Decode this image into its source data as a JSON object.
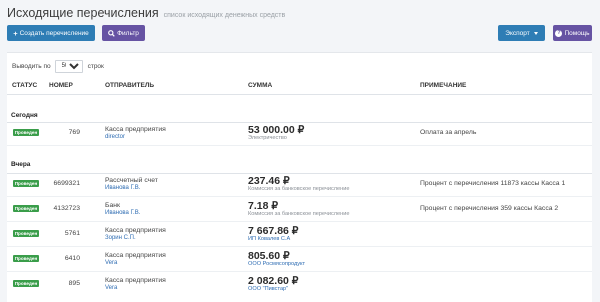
{
  "header": {
    "title": "Исходящие перечисления",
    "subtitle": "список исходящих денежных средств"
  },
  "toolbar": {
    "create_label": "Создать перечисление",
    "filter_label": "Фильтр",
    "export_label": "Экспорт",
    "help_label": "Помощь"
  },
  "per_page": {
    "prefix": "Выводить по",
    "value": "50",
    "suffix": "строк"
  },
  "columns": {
    "status": "СТАТУС",
    "number": "НОМЕР",
    "sender": "ОТПРАВИТЕЛЬ",
    "amount": "СУММА",
    "note": "ПРИМЕЧАНИЕ"
  },
  "groups": [
    "Сегодня",
    "Вчера"
  ],
  "rows": [
    {
      "status": "Проведен",
      "number": "769",
      "sender": "Касса предприятия",
      "sender_sub": "director",
      "amount": "53 000.00 ₽",
      "desc": "Электричество",
      "note": "Оплата за апрель"
    },
    {
      "status": "Проведен",
      "number": "6699321",
      "sender": "Рассчетный счет",
      "sender_sub": "Иванова Г.В.",
      "amount": "237.46 ₽",
      "desc": "Комиссия за банковское перечисление",
      "note": "Процент с перечисления 11873 кассы Касса 1"
    },
    {
      "status": "Проведен",
      "number": "4132723",
      "sender": "Банк",
      "sender_sub": "Иванова Г.В.",
      "amount": "7.18 ₽",
      "desc": "Комиссия за банковское перечисление",
      "note": "Процент с перечисления 359 кассы Касса 2"
    },
    {
      "status": "Проведен",
      "number": "5761",
      "sender": "Касса предприятия",
      "sender_sub": "Зорин С.П.",
      "amount": "7 667.86 ₽",
      "desc": "ИП Ковалев С.А",
      "note": ""
    },
    {
      "status": "Проведен",
      "number": "6410",
      "sender": "Касса предприятия",
      "sender_sub": "Vera",
      "amount": "805.60 ₽",
      "desc": "ООО Росмясопродукт",
      "note": ""
    },
    {
      "status": "Проведен",
      "number": "895",
      "sender": "Касса предприятия",
      "sender_sub": "Vera",
      "amount": "2 082.60 ₽",
      "desc": "ООО \"Пивстар\"",
      "note": ""
    }
  ],
  "colors": {
    "primary_button": "#2e7db5",
    "secondary_button": "#6653a3",
    "status_badge": "#3a9d4a",
    "link": "#2f6db3"
  }
}
